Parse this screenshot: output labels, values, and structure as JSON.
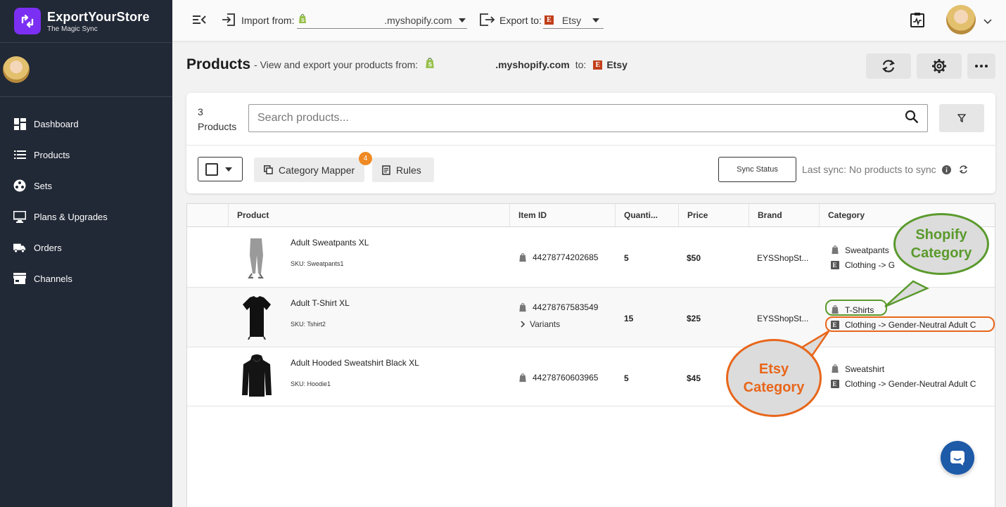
{
  "brand": {
    "name": "ExportYourStore",
    "tagline": "The Magic Sync"
  },
  "sidebar": {
    "items": [
      {
        "label": "Dashboard",
        "icon": "dashboard-icon"
      },
      {
        "label": "Products",
        "icon": "list-icon"
      },
      {
        "label": "Sets",
        "icon": "sets-icon"
      },
      {
        "label": "Plans & Upgrades",
        "icon": "monitor-icon"
      },
      {
        "label": "Orders",
        "icon": "truck-icon"
      },
      {
        "label": "Channels",
        "icon": "store-icon"
      }
    ]
  },
  "topbar": {
    "import_label": "Import from:",
    "import_value": ".myshopify.com",
    "export_label": "Export to:",
    "export_value": "Etsy"
  },
  "header": {
    "title": "Products",
    "subtitle": "- View and export your products from:",
    "store": ".myshopify.com",
    "to_label": "to:",
    "target": "Etsy"
  },
  "toolbar": {
    "count_number": "3",
    "count_label": "Products",
    "search_placeholder": "Search products...",
    "category_mapper_label": "Category Mapper",
    "category_mapper_badge": "4",
    "rules_label": "Rules",
    "sync_status_label": "Sync Status",
    "last_sync": "Last sync: No products to sync"
  },
  "table": {
    "columns": [
      "Product",
      "Item ID",
      "Quanti...",
      "Price",
      "Brand",
      "Category"
    ],
    "rows": [
      {
        "name": "Adult Sweatpants XL",
        "sku": "SKU: Sweatpants1",
        "item_id": "44278774202685",
        "quantity": "5",
        "price": "$50",
        "brand": "EYSShopSt...",
        "shopify_category": "Sweatpants",
        "etsy_category": "Clothing -> G",
        "variants": ""
      },
      {
        "name": "Adult T-Shirt XL",
        "sku": "SKU: Tshirt2",
        "item_id": "44278767583549",
        "quantity": "15",
        "price": "$25",
        "brand": "EYSShopSt...",
        "shopify_category": "T-Shirts",
        "etsy_category": "Clothing -> Gender-Neutral Adult C",
        "variants": "Variants"
      },
      {
        "name": "Adult Hooded Sweatshirt Black XL",
        "sku": "SKU: Hoodie1",
        "item_id": "44278760603965",
        "quantity": "5",
        "price": "$45",
        "brand": "",
        "shopify_category": "Sweatshirt",
        "etsy_category": "Clothing -> Gender-Neutral Adult C",
        "variants": ""
      }
    ]
  },
  "callouts": {
    "shopify": "Shopify Category",
    "etsy": "Etsy Category",
    "shopify_color": "#5a9a2c",
    "etsy_color": "#e8661a"
  }
}
